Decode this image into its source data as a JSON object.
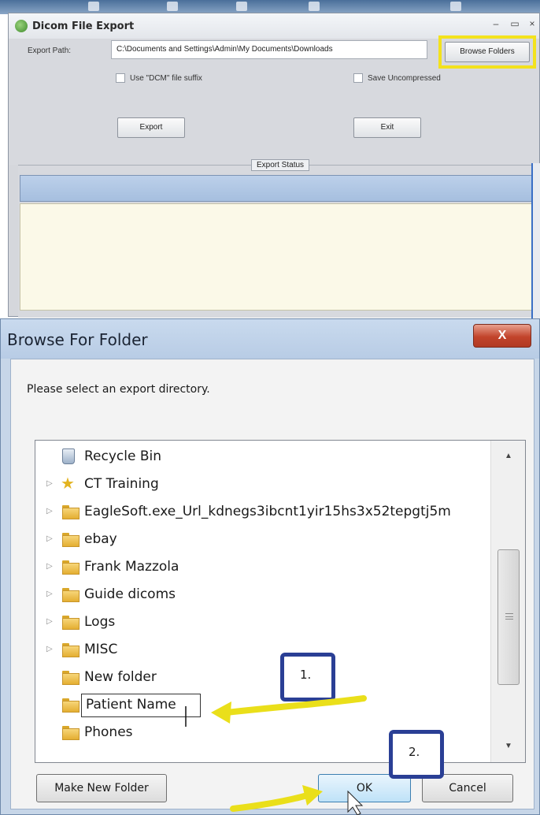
{
  "dicom_window": {
    "title": "Dicom File  Export",
    "export_path_label": "Export Path:",
    "export_path_value": "C:\\Documents and Settings\\Admin\\My Documents\\Downloads",
    "browse_folders_label": "Browse Folders",
    "use_dcm_suffix_label": "Use \"DCM\" file suffix",
    "save_uncompressed_label": "Save Uncompressed",
    "export_button_label": "Export",
    "exit_button_label": "Exit",
    "export_status_label": "Export Status"
  },
  "browse_dialog": {
    "title": "Browse For Folder",
    "close_label": "X",
    "instruction": "Please select an export directory.",
    "tree_items": [
      {
        "label": "Recycle Bin",
        "icon": "recycle-bin-icon",
        "expandable": false
      },
      {
        "label": "CT Training",
        "icon": "star-icon",
        "expandable": true
      },
      {
        "label": "EagleSoft.exe_Url_kdnegs3ibcnt1yir15hs3x52tepgtj5m",
        "icon": "folder-icon",
        "expandable": true
      },
      {
        "label": "ebay",
        "icon": "folder-icon",
        "expandable": true
      },
      {
        "label": "Frank Mazzola",
        "icon": "folder-icon",
        "expandable": true
      },
      {
        "label": "Guide dicoms",
        "icon": "folder-icon",
        "expandable": true
      },
      {
        "label": "Logs",
        "icon": "folder-icon",
        "expandable": true
      },
      {
        "label": "MISC",
        "icon": "folder-icon",
        "expandable": true
      },
      {
        "label": "New folder",
        "icon": "folder-icon",
        "expandable": false
      },
      {
        "label": "Patient Name",
        "icon": "folder-icon",
        "expandable": false,
        "editing": true
      },
      {
        "label": "Phones",
        "icon": "folder-icon",
        "expandable": false
      }
    ],
    "make_new_folder_label": "Make New Folder",
    "ok_label": "OK",
    "cancel_label": "Cancel"
  },
  "annotations": {
    "callout_1": "1.",
    "callout_2": "2."
  },
  "colors": {
    "highlight_yellow": "#f3e21d",
    "callout_border": "#2a3f95",
    "arrow_yellow": "#eadf1a",
    "close_red": "#c2442b"
  }
}
